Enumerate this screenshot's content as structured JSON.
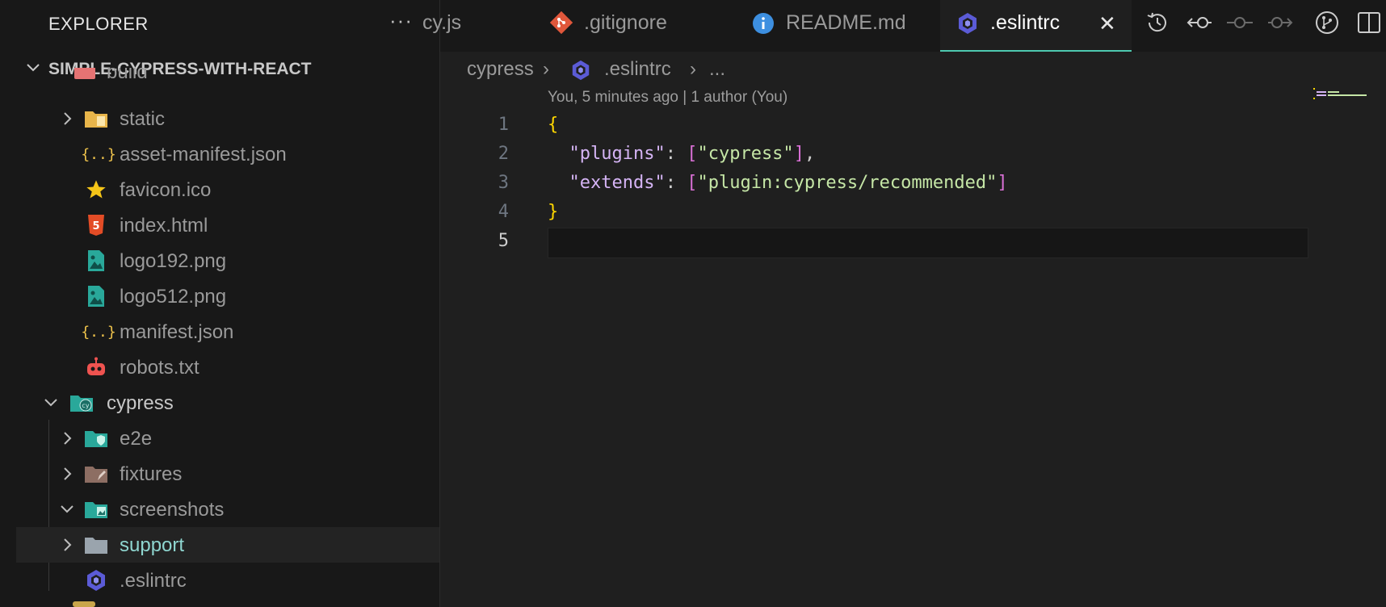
{
  "sidebar": {
    "title": "EXPLORER",
    "more_label": "···",
    "project": "SIMPLE-CYPRESS-WITH-REACT",
    "tree": [
      {
        "label": "build",
        "icon": "build-folder-icon"
      },
      {
        "label": "static",
        "icon": "folder-icon"
      },
      {
        "label": "asset-manifest.json",
        "icon": "json-icon"
      },
      {
        "label": "favicon.ico",
        "icon": "star-icon"
      },
      {
        "label": "index.html",
        "icon": "html-icon"
      },
      {
        "label": "logo192.png",
        "icon": "image-icon"
      },
      {
        "label": "logo512.png",
        "icon": "image-icon"
      },
      {
        "label": "manifest.json",
        "icon": "json-icon"
      },
      {
        "label": "robots.txt",
        "icon": "robot-icon"
      },
      {
        "label": "cypress",
        "icon": "cypress-folder-icon"
      },
      {
        "label": "e2e",
        "icon": "e2e-folder-icon"
      },
      {
        "label": "fixtures",
        "icon": "fixtures-folder-icon"
      },
      {
        "label": "screenshots",
        "icon": "screenshots-folder-icon"
      },
      {
        "label": "support",
        "icon": "folder-icon"
      },
      {
        "label": ".eslintrc",
        "icon": "eslint-icon"
      }
    ]
  },
  "tabs": [
    {
      "label": "cy.js",
      "icon": "js-icon"
    },
    {
      "label": ".gitignore",
      "icon": "git-icon"
    },
    {
      "label": "README.md",
      "icon": "info-icon"
    },
    {
      "label": ".eslintrc",
      "icon": "eslint-icon",
      "active": true,
      "close": "✕"
    }
  ],
  "toolbar_icons": [
    "timeline-icon",
    "previous-change-icon",
    "commit-icon",
    "next-change-icon",
    "git-graph-icon",
    "split-editor-icon"
  ],
  "breadcrumb": {
    "folder": "cypress",
    "sep": "›",
    "file": ".eslintrc",
    "more": "..."
  },
  "codelens": "You, 5 minutes ago | 1 author (You)",
  "editor": {
    "line_numbers": [
      "1",
      "2",
      "3",
      "4",
      "5"
    ],
    "current_line": 5,
    "code": {
      "open_brace": "{",
      "plugins_key": "\"plugins\"",
      "colon": ": ",
      "open_bracket": "[",
      "plugins_value": "\"cypress\"",
      "close_bracket": "]",
      "comma": ",",
      "extends_key": "\"extends\"",
      "extends_value": "\"plugin:cypress/recommended\"",
      "close_brace": "}"
    }
  },
  "colors": {
    "accent": "#4ec9b0",
    "folder": "#e8b54a",
    "json": "#f0c44c",
    "html": "#e34c26",
    "image": "#29a89a",
    "eslint": "#5b5bd6",
    "git": "#e0573b",
    "info": "#3d8fe0"
  }
}
